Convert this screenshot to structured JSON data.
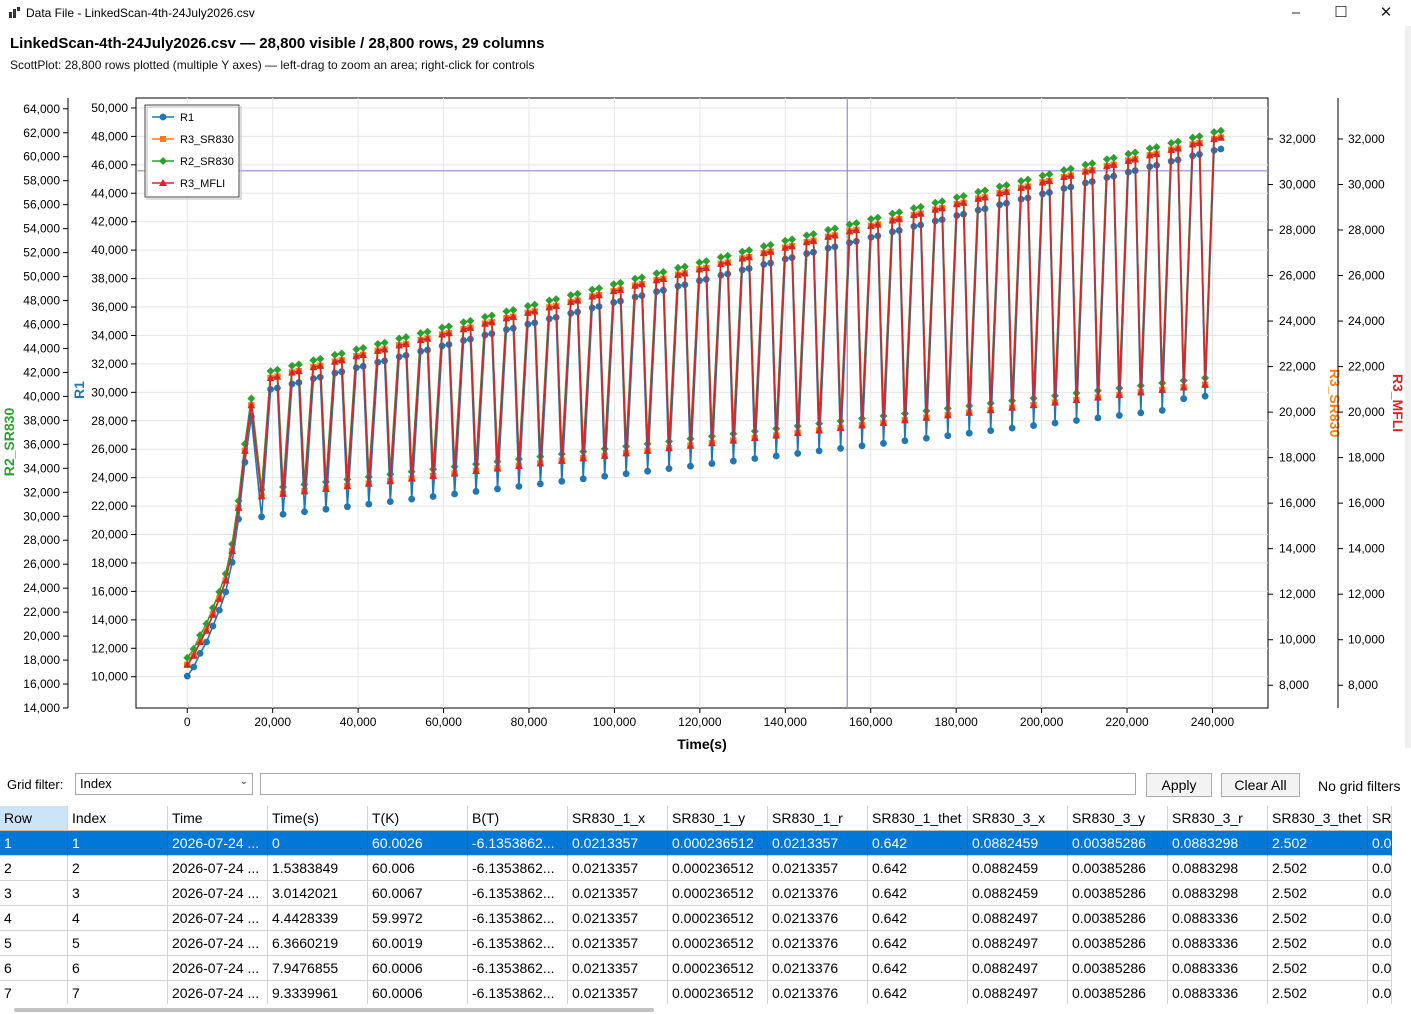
{
  "window": {
    "title": "Data File - LinkedScan-4th-24July2026.csv"
  },
  "header": {
    "title": "LinkedScan-4th-24July2026.csv — 28,800 visible / 28,800 rows, 29 columns",
    "subtitle": "ScottPlot: 28,800 rows plotted (multiple Y axes) — left-drag to zoom an area; right-click for controls"
  },
  "colors": {
    "R1": "#1f77b4",
    "R3_SR830": "#ff7f0e",
    "R2_SR830": "#2ca02c",
    "R3_MFLI": "#d62728",
    "selection": "#0078d7",
    "crosshair": "#9a86d0"
  },
  "chart_data": {
    "type": "line",
    "xlabel": "Time(s)",
    "xlim": [
      -12000,
      253000
    ],
    "xticks": [
      0,
      20000,
      40000,
      60000,
      80000,
      100000,
      120000,
      140000,
      160000,
      180000,
      200000,
      220000,
      240000
    ],
    "xtick_labels": [
      "0",
      "20,000",
      "40,000",
      "60,000",
      "80,000",
      "100,000",
      "120,000",
      "140,000",
      "160,000",
      "180,000",
      "200,000",
      "220,000",
      "240,000"
    ],
    "crosshair": {
      "x": 154500,
      "r3_sr830": 30600
    },
    "legend_position": "top-left",
    "grid": true,
    "axes": {
      "R2_SR830": {
        "side": "left-outer",
        "ylim": [
          14000,
          64900
        ],
        "ticks": [
          14000,
          16000,
          18000,
          20000,
          22000,
          24000,
          26000,
          28000,
          30000,
          32000,
          34000,
          36000,
          38000,
          40000,
          42000,
          44000,
          46000,
          48000,
          50000,
          52000,
          54000,
          56000,
          58000,
          60000,
          62000,
          64000
        ],
        "tick_labels": [
          "14,000",
          "16,000",
          "18,000",
          "20,000",
          "22,000",
          "24,000",
          "26,000",
          "28,000",
          "30,000",
          "32,000",
          "34,000",
          "36,000",
          "38,000",
          "40,000",
          "42,000",
          "44,000",
          "46,000",
          "48,000",
          "50,000",
          "52,000",
          "54,000",
          "56,000",
          "58,000",
          "60,000",
          "62,000",
          "64,000"
        ]
      },
      "R1": {
        "side": "left-inner",
        "ylim": [
          7800,
          50700
        ],
        "ticks": [
          10000,
          12000,
          14000,
          16000,
          18000,
          20000,
          22000,
          24000,
          26000,
          28000,
          30000,
          32000,
          34000,
          36000,
          38000,
          40000,
          42000,
          44000,
          46000,
          48000,
          50000
        ],
        "tick_labels": [
          "10,000",
          "12,000",
          "14,000",
          "16,000",
          "18,000",
          "20,000",
          "22,000",
          "24,000",
          "26,000",
          "28,000",
          "30,000",
          "32,000",
          "34,000",
          "36,000",
          "38,000",
          "40,000",
          "42,000",
          "44,000",
          "46,000",
          "48,000",
          "50,000"
        ]
      },
      "R3_SR830": {
        "side": "right-inner",
        "ylim": [
          7000,
          33800
        ],
        "ticks": [
          8000,
          10000,
          12000,
          14000,
          16000,
          18000,
          20000,
          22000,
          24000,
          26000,
          28000,
          30000,
          32000
        ],
        "tick_labels": [
          "8,000",
          "10,000",
          "12,000",
          "14,000",
          "16,000",
          "18,000",
          "20,000",
          "22,000",
          "24,000",
          "26,000",
          "28,000",
          "30,000",
          "32,000"
        ]
      },
      "R3_MFLI": {
        "side": "right-outer",
        "ylim": [
          7000,
          33800
        ],
        "ticks": [
          8000,
          10000,
          12000,
          14000,
          16000,
          18000,
          20000,
          22000,
          24000,
          26000,
          28000,
          30000,
          32000
        ],
        "tick_labels": [
          "8,000",
          "10,000",
          "12,000",
          "14,000",
          "16,000",
          "18,000",
          "20,000",
          "22,000",
          "24,000",
          "26,000",
          "28,000",
          "30,000",
          "32,000"
        ]
      }
    },
    "series": [
      {
        "name": "R1",
        "axis": "R1",
        "marker": "circle"
      },
      {
        "name": "R3_SR830",
        "axis": "R3_SR830",
        "marker": "square"
      },
      {
        "name": "R2_SR830",
        "axis": "R2_SR830",
        "marker": "diamond"
      },
      {
        "name": "R3_MFLI",
        "axis": "R3_MFLI",
        "marker": "triangle"
      }
    ],
    "ramp": {
      "t": [
        0,
        1500,
        3000,
        4500,
        6000,
        7500,
        9000,
        10500,
        12000,
        13500,
        15000
      ],
      "r3": [
        8900,
        9300,
        9900,
        10400,
        11100,
        11800,
        12600,
        13900,
        15800,
        18300,
        20300
      ]
    },
    "cycles": {
      "start_t": 17400,
      "period": 5020,
      "count": 45,
      "r3_low_start": 16300,
      "r3_low_end": 21200,
      "r3_high_start": 21500,
      "r3_high_end": 32000
    }
  },
  "filter": {
    "label": "Grid filter:",
    "column": "Index",
    "text": "",
    "apply": "Apply",
    "clear": "Clear All",
    "status": "No grid filters"
  },
  "grid": {
    "columns": [
      "Row",
      "Index",
      "Time",
      "Time(s)",
      "T(K)",
      "B(T)",
      "SR830_1_x",
      "SR830_1_y",
      "SR830_1_r",
      "SR830_1_thet",
      "SR830_3_x",
      "SR830_3_y",
      "SR830_3_r",
      "SR830_3_thet",
      "SR"
    ],
    "rows": [
      [
        "1",
        "1",
        "2026-07-24 ...",
        "0",
        "60.0026",
        "-6.1353862...",
        "0.0213357",
        "0.000236512",
        "0.0213357",
        "0.642",
        "0.0882459",
        "0.00385286",
        "0.0883298",
        "2.502",
        "0.0"
      ],
      [
        "2",
        "2",
        "2026-07-24 ...",
        "1.5383849",
        "60.006",
        "-6.1353862...",
        "0.0213357",
        "0.000236512",
        "0.0213357",
        "0.642",
        "0.0882459",
        "0.00385286",
        "0.0883298",
        "2.502",
        "0.0"
      ],
      [
        "3",
        "3",
        "2026-07-24 ...",
        "3.0142021",
        "60.0067",
        "-6.1353862...",
        "0.0213357",
        "0.000236512",
        "0.0213376",
        "0.642",
        "0.0882459",
        "0.00385286",
        "0.0883298",
        "2.502",
        "0.0"
      ],
      [
        "4",
        "4",
        "2026-07-24 ...",
        "4.4428339",
        "59.9972",
        "-6.1353862...",
        "0.0213357",
        "0.000236512",
        "0.0213376",
        "0.642",
        "0.0882497",
        "0.00385286",
        "0.0883336",
        "2.502",
        "0.0"
      ],
      [
        "5",
        "5",
        "2026-07-24 ...",
        "6.3660219",
        "60.0019",
        "-6.1353862...",
        "0.0213357",
        "0.000236512",
        "0.0213376",
        "0.642",
        "0.0882497",
        "0.00385286",
        "0.0883336",
        "2.502",
        "0.0"
      ],
      [
        "6",
        "6",
        "2026-07-24 ...",
        "7.9476855",
        "60.0006",
        "-6.1353862...",
        "0.0213357",
        "0.000236512",
        "0.0213376",
        "0.642",
        "0.0882497",
        "0.00385286",
        "0.0883336",
        "2.502",
        "0.0"
      ],
      [
        "7",
        "7",
        "2026-07-24 ...",
        "9.3339961",
        "60.0006",
        "-6.1353862...",
        "0.0213357",
        "0.000236512",
        "0.0213376",
        "0.642",
        "0.0882497",
        "0.00385286",
        "0.0883336",
        "2.502",
        "0.0"
      ]
    ]
  }
}
